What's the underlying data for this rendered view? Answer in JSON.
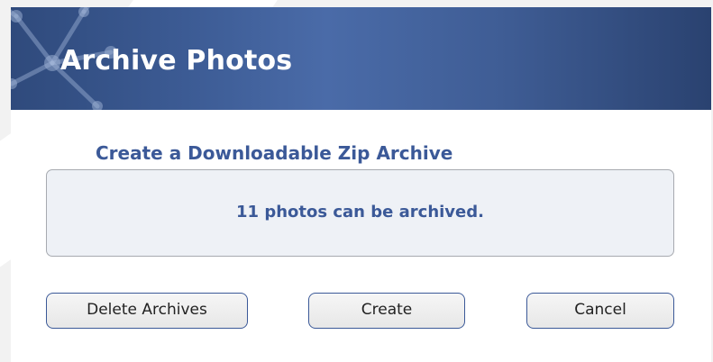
{
  "dialog": {
    "title": "Archive Photos",
    "header_gradient": [
      "#2f4a7c",
      "#4a6ba8",
      "#2a4270"
    ],
    "decor_icon": "network-nodes-icon"
  },
  "content": {
    "section_title": "Create a Downloadable Zip Archive",
    "status_message": "11 photos can be archived.",
    "accent_color": "#3b5998"
  },
  "buttons": {
    "delete_label": "Delete Archives",
    "create_label": "Create",
    "cancel_label": "Cancel"
  }
}
